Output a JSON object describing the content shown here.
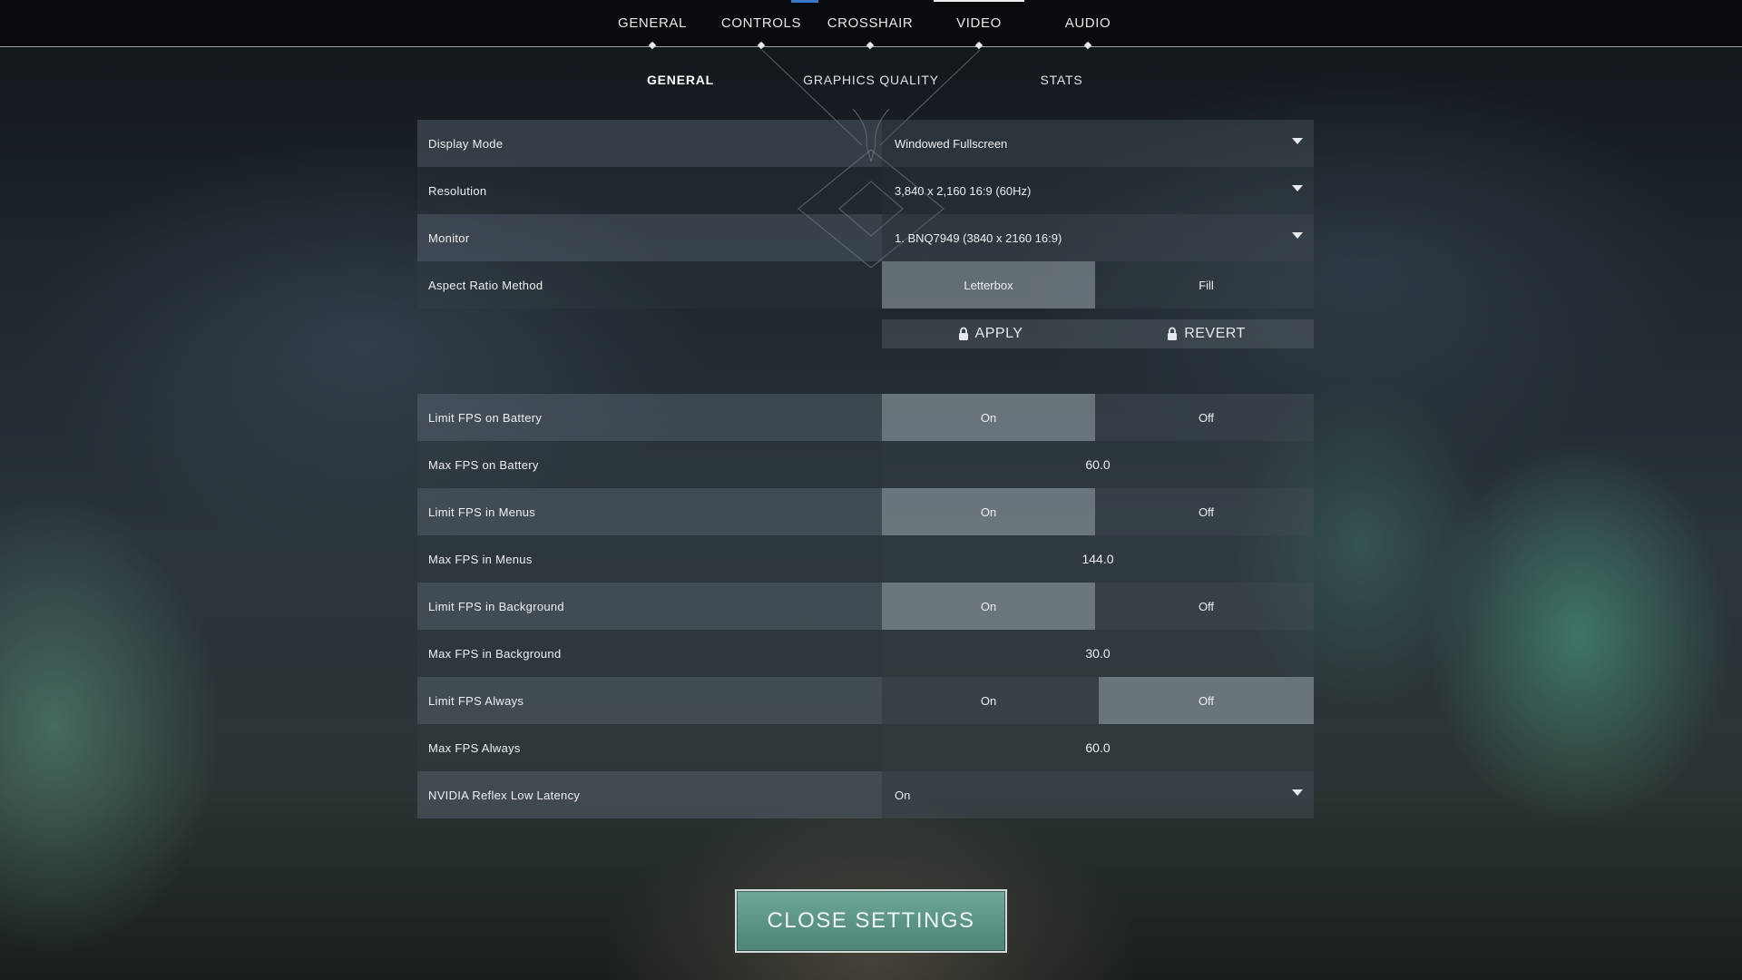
{
  "top_tabs": [
    {
      "label": "GENERAL"
    },
    {
      "label": "CONTROLS"
    },
    {
      "label": "CROSSHAIR"
    },
    {
      "label": "VIDEO"
    },
    {
      "label": "AUDIO"
    }
  ],
  "active_top_tab": "VIDEO",
  "sub_tabs": [
    {
      "label": "GENERAL"
    },
    {
      "label": "GRAPHICS QUALITY"
    },
    {
      "label": "STATS"
    }
  ],
  "active_sub_tab": "GENERAL",
  "display_settings": {
    "display_mode": {
      "label": "Display Mode",
      "value": "Windowed Fullscreen"
    },
    "resolution": {
      "label": "Resolution",
      "value": "3,840 x 2,160 16:9 (60Hz)"
    },
    "monitor": {
      "label": "Monitor",
      "value": "1. BNQ7949 (3840 x  2160 16:9)"
    },
    "aspect_ratio": {
      "label": "Aspect Ratio Method",
      "option_a": "Letterbox",
      "option_b": "Fill",
      "selected": "Letterbox"
    }
  },
  "apply_bar": {
    "apply": "APPLY",
    "revert": "REVERT"
  },
  "fps_settings": {
    "limit_battery": {
      "label": "Limit FPS on Battery",
      "on": "On",
      "off": "Off",
      "selected": "On"
    },
    "max_battery": {
      "label": "Max FPS on Battery",
      "value": "60.0"
    },
    "limit_menus": {
      "label": "Limit FPS in Menus",
      "on": "On",
      "off": "Off",
      "selected": "On"
    },
    "max_menus": {
      "label": "Max FPS in Menus",
      "value": "144.0"
    },
    "limit_background": {
      "label": "Limit FPS in Background",
      "on": "On",
      "off": "Off",
      "selected": "On"
    },
    "max_background": {
      "label": "Max FPS in Background",
      "value": "30.0"
    },
    "limit_always": {
      "label": "Limit FPS Always",
      "on": "On",
      "off": "Off",
      "selected": "Off"
    },
    "max_always": {
      "label": "Max FPS Always",
      "value": "60.0"
    },
    "reflex": {
      "label": "NVIDIA Reflex Low Latency",
      "value": "On"
    }
  },
  "close_button": "CLOSE SETTINGS",
  "colors": {
    "accent_teal": "#5c9487",
    "selected_toggle": "#8f99a1",
    "top_accent_blue": "#3a78c8"
  }
}
